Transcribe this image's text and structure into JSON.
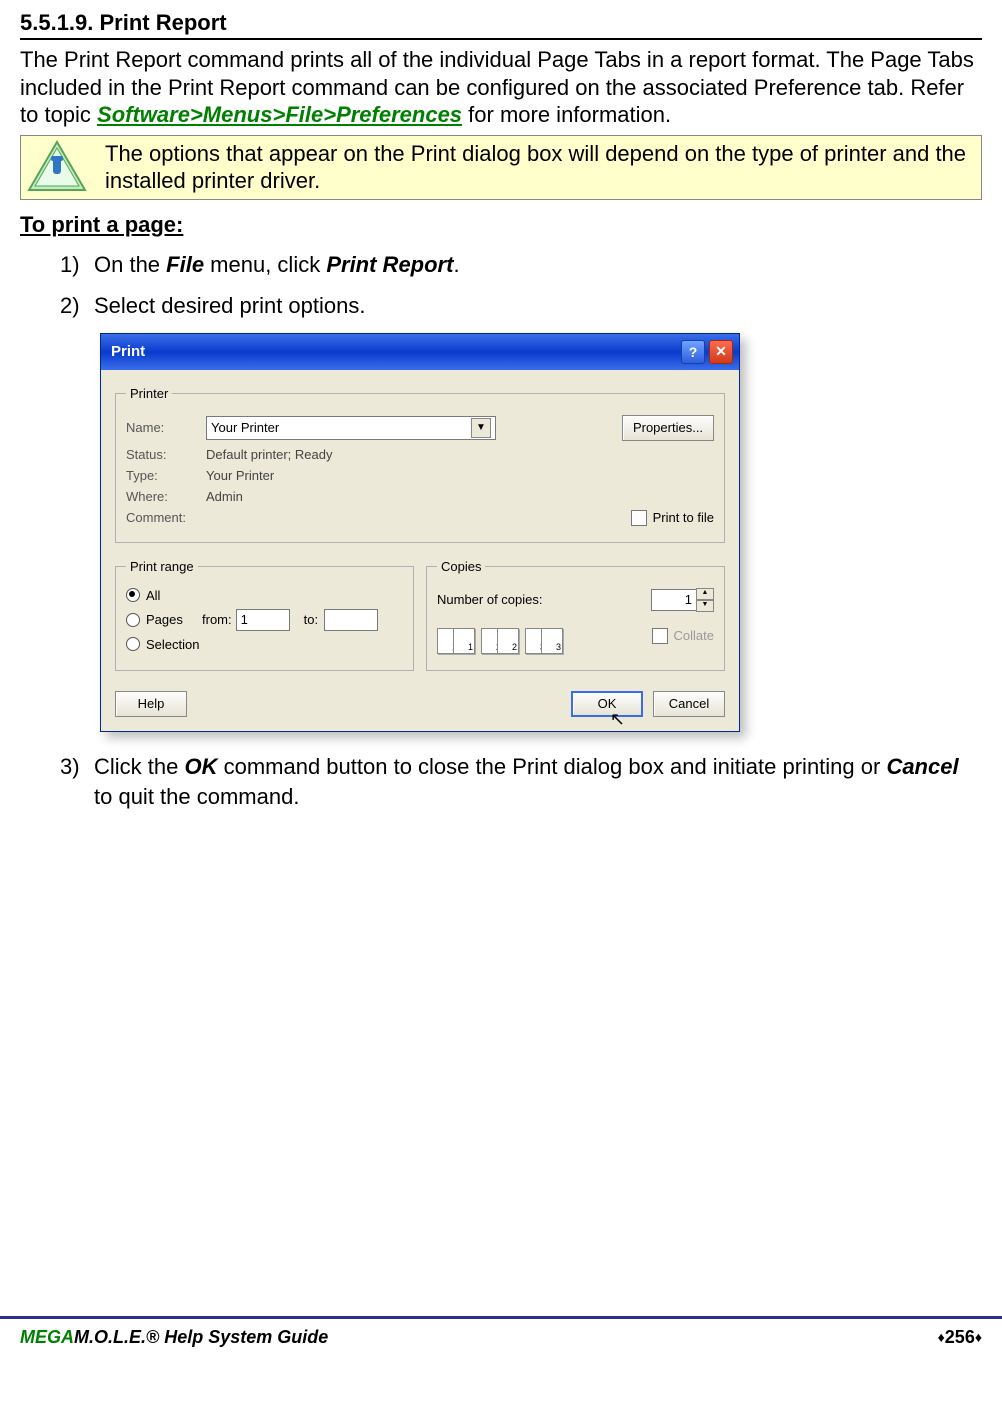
{
  "section_number": "5.5.1.9. Print Report",
  "intro_parts": {
    "p1": "The Print Report command prints all of the individual Page Tabs in a report format. The Page Tabs included in the Print Report command can be configured on the associated Preference tab. Refer to topic ",
    "link": "Software>Menus>File>Preferences",
    "p2": " for more information."
  },
  "note": "The options that appear on the Print dialog box will depend on the type of printer and the installed printer driver.",
  "subhead": "To print a page:",
  "steps": {
    "s1_a": "On the ",
    "s1_b": "File",
    "s1_c": " menu, click ",
    "s1_d": "Print Report",
    "s1_e": ".",
    "s2": "Select desired print options.",
    "s3_a": "Click the ",
    "s3_b": "OK",
    "s3_c": " command button to close the Print dialog box and initiate printing or ",
    "s3_d": "Cancel",
    "s3_e": " to quit the command."
  },
  "dialog": {
    "title": "Print",
    "printer_group": "Printer",
    "name_label": "Name:",
    "name_value": "Your  Printer",
    "properties_btn": "Properties...",
    "status_label": "Status:",
    "status_value": "Default printer; Ready",
    "type_label": "Type:",
    "type_value": "Your  Printer",
    "where_label": "Where:",
    "where_value": "Admin",
    "comment_label": "Comment:",
    "print_to_file": "Print to file",
    "range_group": "Print range",
    "range_all": "All",
    "range_pages": "Pages",
    "range_from": "from:",
    "range_from_value": "1",
    "range_to": "to:",
    "range_to_value": "",
    "range_selection": "Selection",
    "copies_group": "Copies",
    "copies_label": "Number of copies:",
    "copies_value": "1",
    "collate_label": "Collate",
    "help_btn": "Help",
    "ok_btn": "OK",
    "cancel_btn": "Cancel",
    "page_icons": [
      "1",
      "1",
      "2",
      "2",
      "3",
      "3"
    ]
  },
  "footer": {
    "brand_prefix": "MEGA",
    "brand_rest": "M.O.L.E.® Help System Guide",
    "page": "256"
  }
}
